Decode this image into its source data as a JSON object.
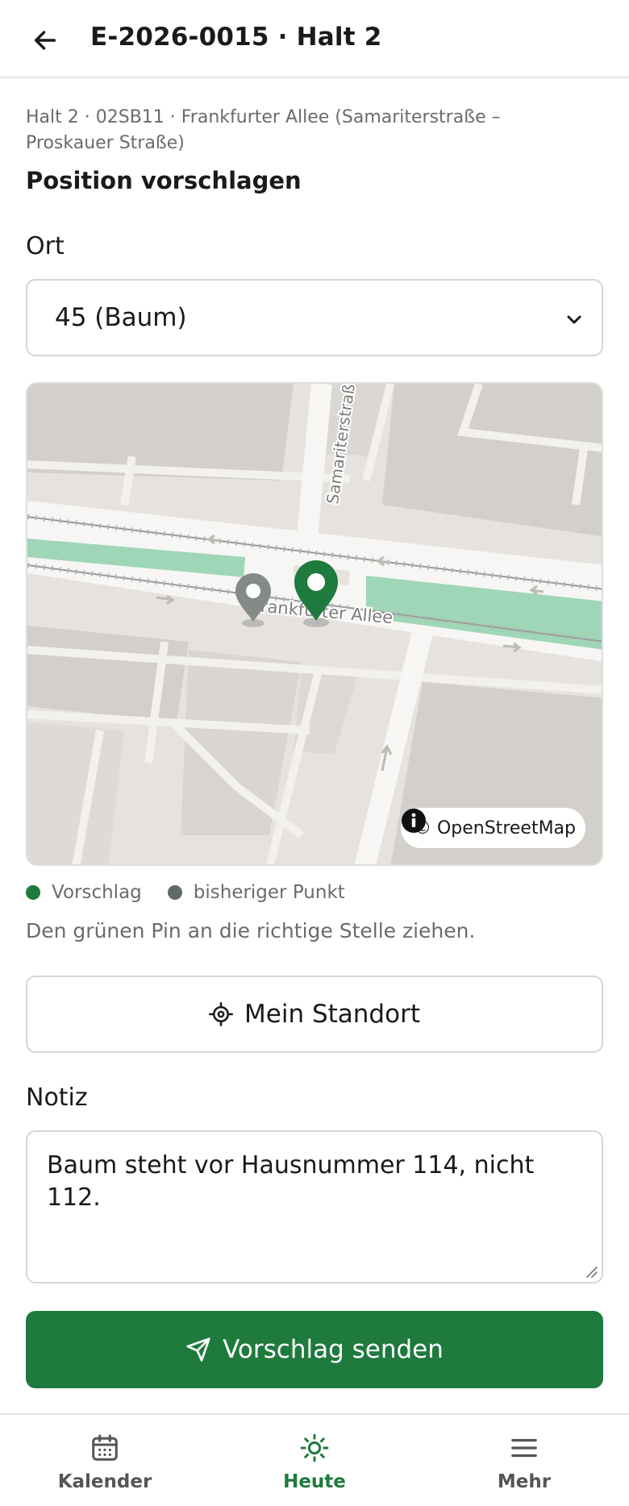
{
  "header": {
    "title": "E-2026-0015 · Halt 2",
    "back_icon": "arrow-left-icon"
  },
  "stop": {
    "subtitle": "Halt 2 · 02SB11 · Frankfurter Allee (Samariterstraße – Proskauer Straße)"
  },
  "form": {
    "section_title": "Position vorschlagen",
    "location_label": "Ort",
    "location_selected": "45 (Baum)",
    "note_label": "Notiz",
    "note_value": "Baum steht vor Hausnummer 114, nicht 112.",
    "locate_button_label": "Mein Standort",
    "locate_icon": "crosshair-icon",
    "submit_button_label": "Vorschlag senden",
    "submit_icon": "send-icon"
  },
  "map": {
    "street_labels": [
      "Samariterstraße",
      "Frankfurter Allee"
    ],
    "attribution": "© OpenStreetMap",
    "info_icon": "info-icon",
    "pins": [
      {
        "name": "Vorschlag",
        "color": "#1f7a3d"
      },
      {
        "name": "bisheriger Punkt",
        "color": "#848a86"
      }
    ]
  },
  "legend": {
    "items": [
      {
        "label": "Vorschlag",
        "color": "#1f7a3d"
      },
      {
        "label": "bisheriger Punkt",
        "color": "#5f6b63"
      }
    ],
    "hint": "Den grünen Pin an die richtige Stelle ziehen."
  },
  "nav": {
    "items": [
      {
        "label": "Kalender",
        "icon": "calendar-icon",
        "active": false
      },
      {
        "label": "Heute",
        "icon": "sun-icon",
        "active": true
      },
      {
        "label": "Mehr",
        "icon": "menu-icon",
        "active": false
      }
    ],
    "active_color": "#1f7a3d",
    "inactive_color": "#555555"
  },
  "colors": {
    "accent": "#1f7a3d",
    "muted_text": "#6b6b6b"
  }
}
